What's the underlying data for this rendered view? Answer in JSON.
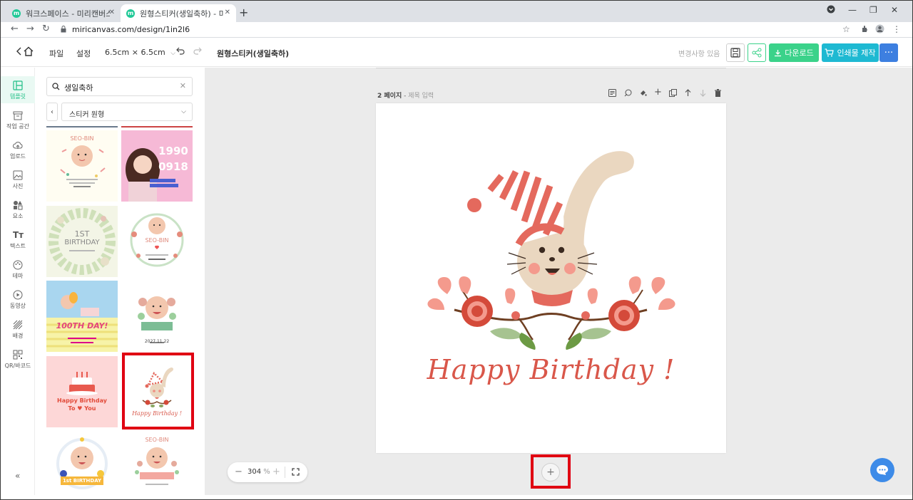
{
  "browser": {
    "tabs": [
      {
        "title": "워크스페이스 - 미리캔버스",
        "active": false
      },
      {
        "title": "원형스티커(생일축하) - 미리캔버",
        "active": true
      }
    ],
    "url": "miricanvas.com/design/1in2l6"
  },
  "header": {
    "file": "파일",
    "settings": "설정",
    "size": "6.5cm × 6.5cm",
    "doc_title": "원형스티커(생일축하)",
    "saved_status": "변경사항 있음",
    "download": "다운로드",
    "print": "인쇄물 제작",
    "more": "···"
  },
  "rail": [
    {
      "label": "템플릿",
      "icon": "template-icon",
      "active": true
    },
    {
      "label": "작업 공간",
      "icon": "workspace-icon",
      "active": false
    },
    {
      "label": "업로드",
      "icon": "upload-icon",
      "active": false
    },
    {
      "label": "사진",
      "icon": "photo-icon",
      "active": false
    },
    {
      "label": "요소",
      "icon": "elements-icon",
      "active": false
    },
    {
      "label": "텍스트",
      "icon": "text-icon",
      "active": false
    },
    {
      "label": "테마",
      "icon": "theme-icon",
      "active": false
    },
    {
      "label": "동영상",
      "icon": "video-icon",
      "active": false
    },
    {
      "label": "배경",
      "icon": "background-icon",
      "active": false
    },
    {
      "label": "QR/바코드",
      "icon": "qr-icon",
      "active": false
    }
  ],
  "panel": {
    "search_value": "생일축하",
    "filter_value": "스티커 원형",
    "thumbs": {
      "t1": {
        "title": "SEO-BIN"
      },
      "t2": {
        "line1": "1990",
        "line2": "0918"
      },
      "t3": {
        "line1": "1ST",
        "line2": "BIRTHDAY"
      },
      "t4": {
        "title": "SEO-BIN"
      },
      "t5": {
        "title": "100TH DAY!"
      },
      "t6": {
        "date": "2027.11.22"
      },
      "t7": {
        "line1": "Happy Birthday",
        "line2": "To",
        "line3": "You"
      },
      "t8": {
        "title": "Happy Birthday !"
      },
      "t9": {
        "title": "1st BIRTHDAY"
      },
      "t10": {
        "title": "SEO-BIN"
      }
    }
  },
  "canvas": {
    "page_number": "2 페이지",
    "page_title_placeholder": "제목 입력",
    "greeting": "Happy Birthday !",
    "zoom": "304",
    "zoom_unit": "%"
  },
  "colors": {
    "accent_green": "#3bd28a",
    "accent_teal": "#1eb9d2",
    "highlight_red": "#e00012"
  }
}
